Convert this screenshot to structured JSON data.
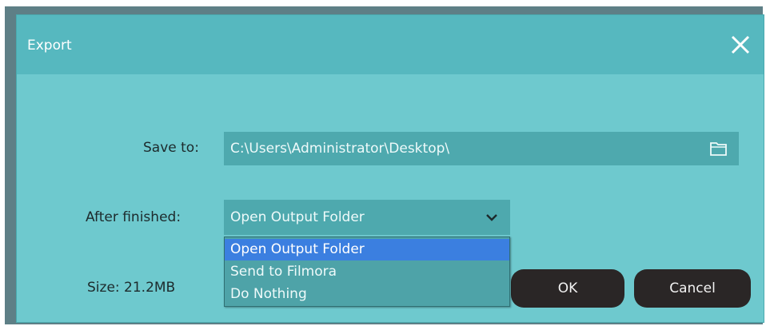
{
  "dialog": {
    "title": "Export",
    "close_icon": "close-icon"
  },
  "save_to": {
    "label": "Save to:",
    "value": "C:\\Users\\Administrator\\Desktop\\",
    "browse_icon": "folder-icon"
  },
  "after_finished": {
    "label": "After finished:",
    "selected": "Open Output Folder",
    "chevron_icon": "chevron-down-icon",
    "options": [
      "Open Output Folder",
      "Send to Filmora",
      "Do Nothing"
    ]
  },
  "size": {
    "text": "Size: 21.2MB"
  },
  "buttons": {
    "ok": "OK",
    "cancel": "Cancel"
  },
  "colors": {
    "dialog_bg": "#6ec9ce",
    "titlebar_bg": "#56b8bf",
    "field_bg": "#4ea9ae",
    "button_bg": "#2a2626",
    "selection_bg": "#3b7fe0"
  }
}
